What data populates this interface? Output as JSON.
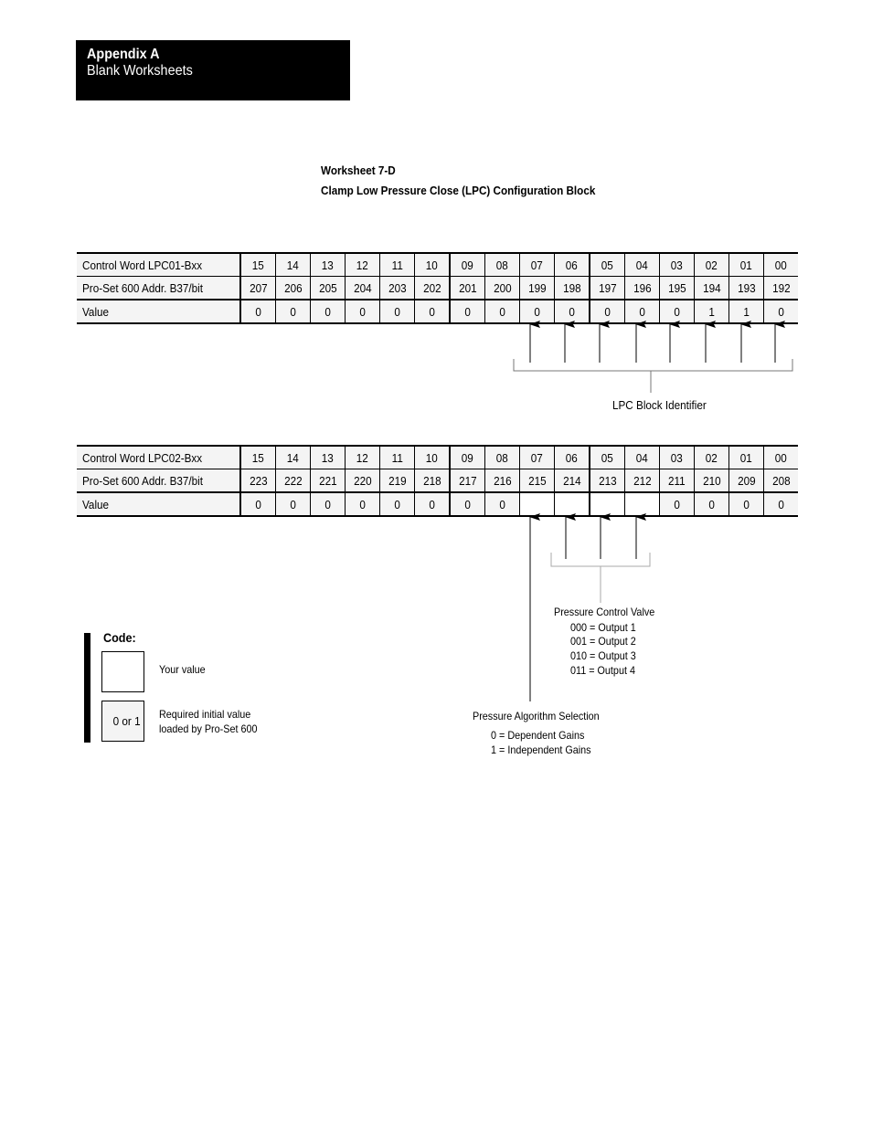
{
  "header": {
    "section": "Appendix A",
    "subtitle": "Blank Worksheets"
  },
  "worksheet": {
    "number": "Worksheet 7-D",
    "title": "Clamp Low Pressure Close (LPC) Configuration Block"
  },
  "tables": [
    {
      "row_labels": [
        "Control Word LPC01-Bxx",
        "Pro-Set 600 Addr. B37/bit",
        "Value"
      ],
      "bits": [
        "15",
        "14",
        "13",
        "12",
        "11",
        "10",
        "09",
        "08",
        "07",
        "06",
        "05",
        "04",
        "03",
        "02",
        "01",
        "00"
      ],
      "addresses": [
        "207",
        "206",
        "205",
        "204",
        "203",
        "202",
        "201",
        "200",
        "199",
        "198",
        "197",
        "196",
        "195",
        "194",
        "193",
        "192"
      ],
      "values": [
        "0",
        "0",
        "0",
        "0",
        "0",
        "0",
        "0",
        "0",
        "0",
        "0",
        "0",
        "0",
        "0",
        "1",
        "1",
        "0"
      ]
    },
    {
      "row_labels": [
        "Control Word LPC02-Bxx",
        "Pro-Set 600 Addr. B37/bit",
        "Value"
      ],
      "bits": [
        "15",
        "14",
        "13",
        "12",
        "11",
        "10",
        "09",
        "08",
        "07",
        "06",
        "05",
        "04",
        "03",
        "02",
        "01",
        "00"
      ],
      "addresses": [
        "223",
        "222",
        "221",
        "220",
        "219",
        "218",
        "217",
        "216",
        "215",
        "214",
        "213",
        "212",
        "211",
        "210",
        "209",
        "208"
      ],
      "values": [
        "0",
        "0",
        "0",
        "0",
        "0",
        "0",
        "0",
        "0",
        "",
        "",
        "",
        "",
        "0",
        "0",
        "0",
        "0"
      ]
    }
  ],
  "annotations": {
    "lpc_block_identifier": "LPC Block Identifier",
    "pressure_control_valve": {
      "title": "Pressure Control Valve",
      "options": [
        "000 = Output 1",
        "001 = Output 2",
        "010 = Output 3",
        "011 = Output 4"
      ]
    },
    "pressure_algorithm": {
      "title": "Pressure Algorithm Selection",
      "options": [
        "0 = Dependent Gains",
        "1 = Independent Gains"
      ]
    }
  },
  "legend": {
    "title": "Code:",
    "items": [
      {
        "box_text": "",
        "label_lines": [
          "Your value"
        ]
      },
      {
        "box_text": "0 or 1",
        "label_lines": [
          "Required initial value",
          "loaded by Pro-Set 600"
        ]
      }
    ]
  }
}
